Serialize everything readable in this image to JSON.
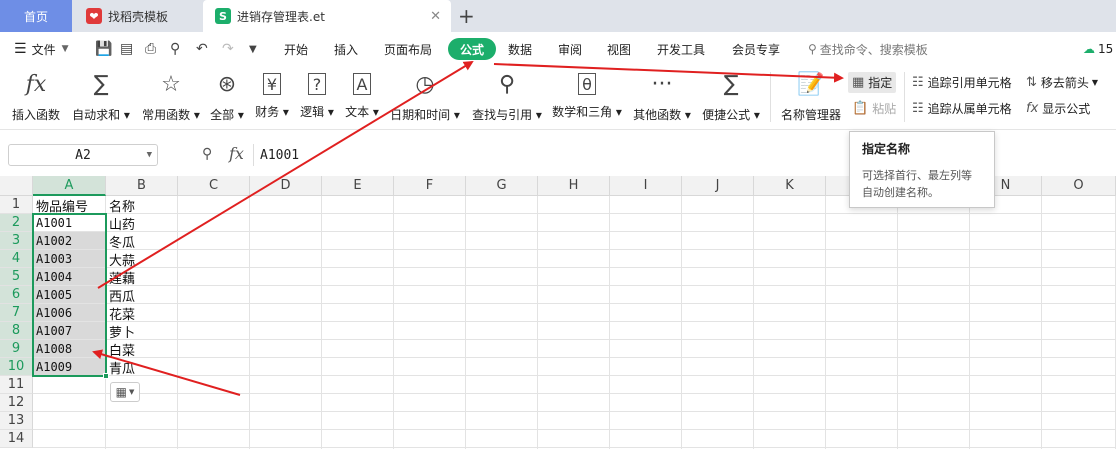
{
  "tabs": {
    "home": "首页",
    "template": "找稻壳模板",
    "doc": "进销存管理表.et",
    "plus": "+"
  },
  "menubar": {
    "file": "文件",
    "items": [
      "开始",
      "插入",
      "页面布局",
      "公式",
      "数据",
      "审阅",
      "视图",
      "开发工具",
      "会员专享"
    ],
    "active": "公式",
    "search": "查找命令、搜索模板",
    "cloud_count": "15"
  },
  "ribbon": {
    "insert_fn": "插入函数",
    "autosum": "自动求和",
    "common": "常用函数",
    "all": "全部",
    "finance": "财务",
    "logic": "逻辑",
    "text": "文本",
    "datetime": "日期和时间",
    "lookup": "查找与引用",
    "math": "数学和三角",
    "other": "其他函数",
    "quick": "便捷公式",
    "name_mgr": "名称管理器",
    "define": "指定",
    "paste": "粘贴",
    "trace_prec": "追踪引用单元格",
    "trace_dep": "追踪从属单元格",
    "remove_arrows": "移去箭头",
    "show_formula": "显示公式"
  },
  "formula_bar": {
    "name_box": "A2",
    "fx": "fx",
    "value": "A1001"
  },
  "tooltip": {
    "title": "指定名称",
    "line1": "可选择首行、最左列等",
    "line2": "自动创建名称。"
  },
  "sheet": {
    "columns": [
      "A",
      "B",
      "C",
      "D",
      "E",
      "F",
      "G",
      "H",
      "I",
      "J",
      "K",
      "L",
      "M",
      "N",
      "O"
    ],
    "rows": [
      "1",
      "2",
      "3",
      "4",
      "5",
      "6",
      "7",
      "8",
      "9",
      "10",
      "11",
      "12",
      "13",
      "14"
    ],
    "header": [
      "物品编号",
      "名称"
    ],
    "data": [
      [
        "A1001",
        "山药"
      ],
      [
        "A1002",
        "冬瓜"
      ],
      [
        "A1003",
        "大蒜"
      ],
      [
        "A1004",
        "莲藕"
      ],
      [
        "A1005",
        "西瓜"
      ],
      [
        "A1006",
        "花菜"
      ],
      [
        "A1007",
        "萝卜"
      ],
      [
        "A1008",
        "白菜"
      ],
      [
        "A1009",
        "青瓜"
      ]
    ]
  },
  "colors": {
    "accent": "#1cae6b",
    "selection": "#1c9a5c",
    "arrow": "#e02020",
    "home_tab": "#6e8ee6"
  }
}
